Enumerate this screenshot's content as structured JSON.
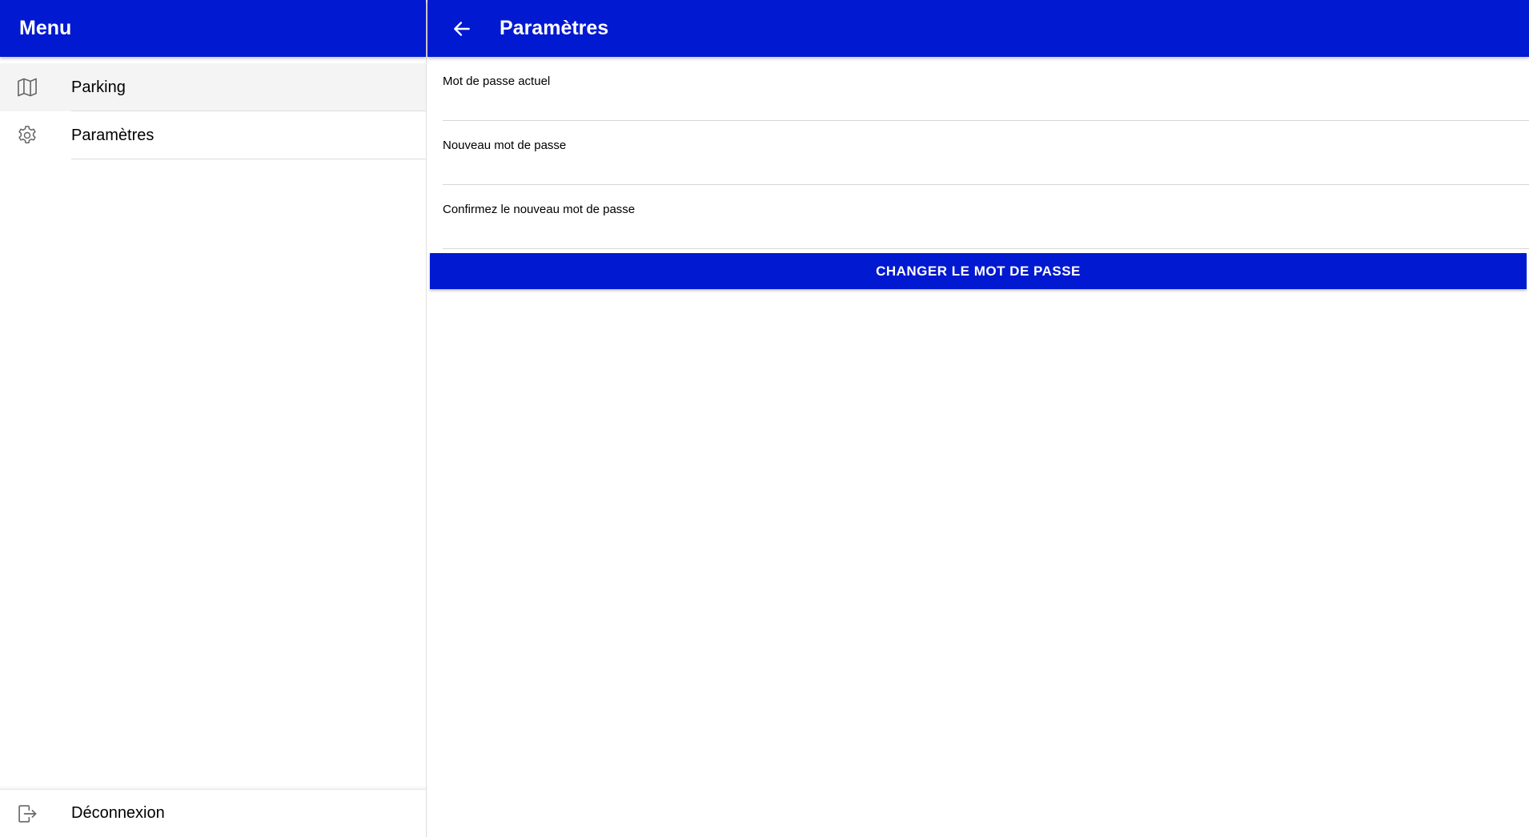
{
  "colors": {
    "primary": "#0019d1",
    "active_item_bg": "#f4f4f4",
    "icon_gray": "#666666"
  },
  "sidebar": {
    "title": "Menu",
    "items": [
      {
        "label": "Parking",
        "icon": "map-icon",
        "active": true
      },
      {
        "label": "Paramètres",
        "icon": "gear-icon",
        "active": false
      }
    ],
    "footer": {
      "label": "Déconnexion",
      "icon": "logout-icon"
    }
  },
  "header": {
    "back_icon": "arrow-left-icon",
    "title": "Paramètres"
  },
  "form": {
    "current_password": {
      "label": "Mot de passe actuel",
      "value": ""
    },
    "new_password": {
      "label": "Nouveau mot de passe",
      "value": ""
    },
    "confirm_password": {
      "label": "Confirmez le nouveau mot de passe",
      "value": ""
    },
    "submit_label": "CHANGER LE MOT DE PASSE"
  }
}
